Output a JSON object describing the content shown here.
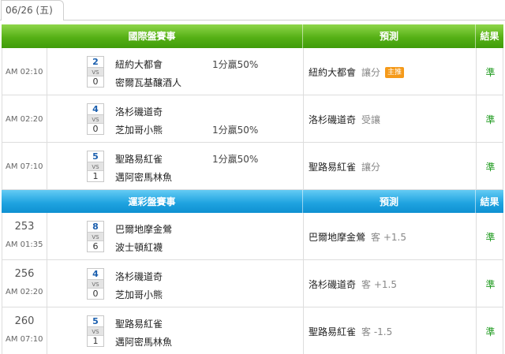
{
  "date_tab": "06/26 (五)",
  "section1": {
    "header": {
      "match": "國際盤賽事",
      "prediction": "預測",
      "result": "結果"
    },
    "rows": [
      {
        "time": "AM 02:10",
        "score_home": "2",
        "vs": "VS",
        "score_away": "0",
        "team1": "紐約大都會",
        "team2": "密爾瓦基釀酒人",
        "odds": "1分贏50%",
        "pred_team": "紐約大都會",
        "pred_type": "讓分",
        "badge": "主推",
        "result": "準"
      },
      {
        "time": "AM 02:20",
        "score_home": "4",
        "vs": "VS",
        "score_away": "0",
        "team1": "洛杉磯道奇",
        "team2": "芝加哥小熊",
        "odds": "1分贏50%",
        "odds_on_team2": true,
        "pred_team": "洛杉磯道奇",
        "pred_type": "受讓",
        "badge": "",
        "result": "準"
      },
      {
        "time": "AM 07:10",
        "score_home": "5",
        "vs": "VS",
        "score_away": "1",
        "team1": "聖路易紅雀",
        "team2": "邁阿密馬林魚",
        "odds": "1分贏50%",
        "pred_team": "聖路易紅雀",
        "pred_type": "讓分",
        "badge": "",
        "result": "準"
      }
    ]
  },
  "section2": {
    "header": {
      "match": "運彩盤賽事",
      "prediction": "預測",
      "result": "結果"
    },
    "rows": [
      {
        "num": "253",
        "time": "AM 01:35",
        "score_home": "8",
        "vs": "VS",
        "score_away": "6",
        "team1": "巴爾地摩金鶯",
        "team2": "波士頓紅襪",
        "pred_team": "巴爾地摩金鶯",
        "pred_type": "客 +1.5",
        "result": "準"
      },
      {
        "num": "256",
        "time": "AM 02:20",
        "score_home": "4",
        "vs": "VS",
        "score_away": "0",
        "team1": "洛杉磯道奇",
        "team2": "芝加哥小熊",
        "pred_team": "洛杉磯道奇",
        "pred_type": "客 +1.5",
        "result": "準"
      },
      {
        "num": "260",
        "time": "AM 07:10",
        "score_home": "5",
        "vs": "VS",
        "score_away": "1",
        "team1": "聖路易紅雀",
        "team2": "邁阿密馬林魚",
        "pred_team": "聖路易紅雀",
        "pred_type": "客 -1.5",
        "result": "準"
      }
    ]
  },
  "colors": {
    "green_header": "#56b016",
    "blue_header": "#1fa3e0",
    "score_home": "#1b5fae",
    "result": "#1e9a1e",
    "badge": "#f59a1a"
  }
}
